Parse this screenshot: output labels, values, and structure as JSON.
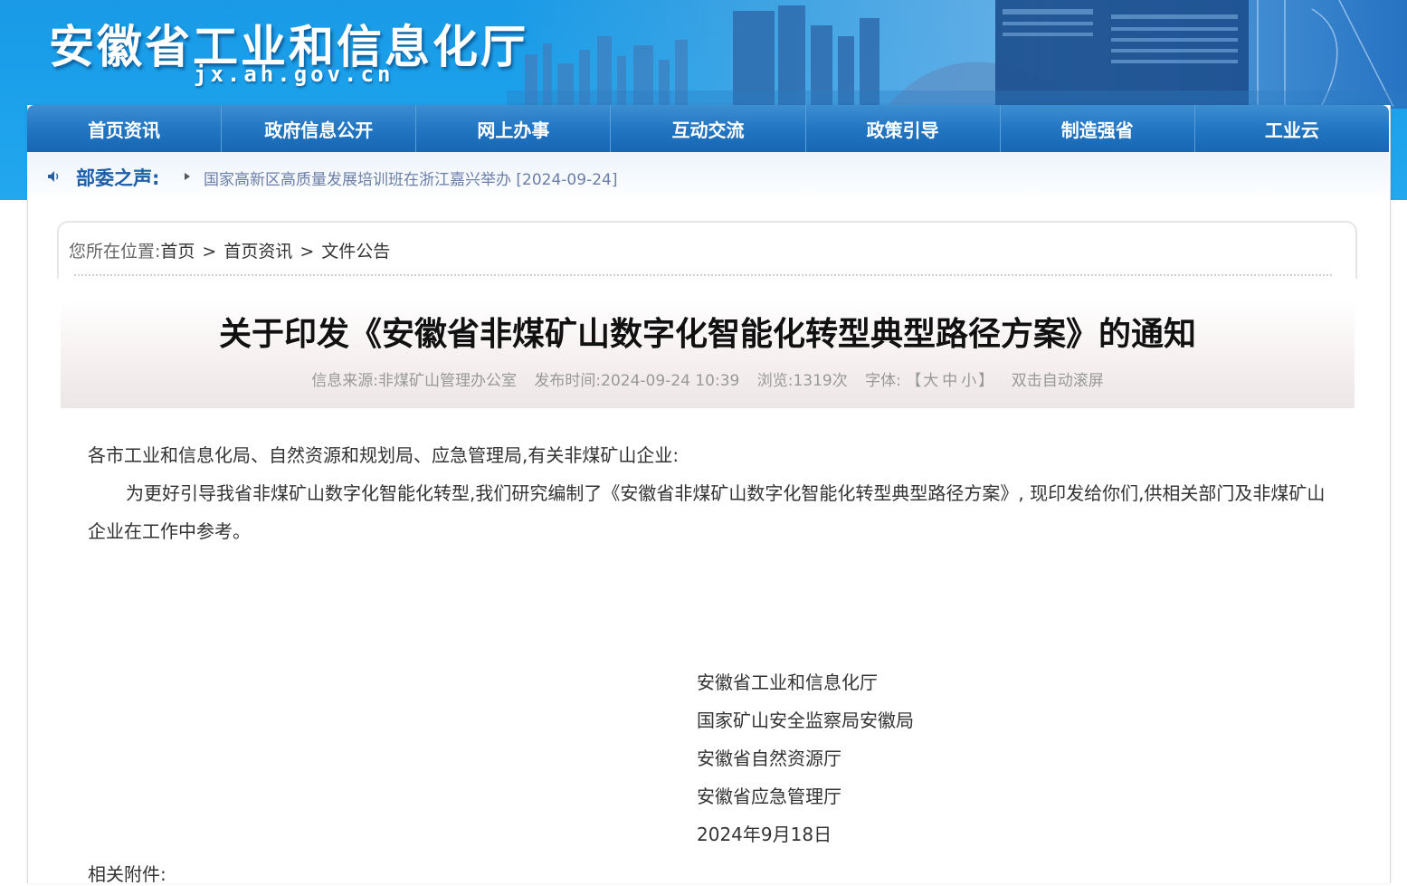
{
  "header": {
    "site_title": "安徽省工业和信息化厅",
    "site_domain": "jx.ah.gov.cn"
  },
  "nav": {
    "items": [
      "首页资讯",
      "政府信息公开",
      "网上办事",
      "互动交流",
      "政策引导",
      "制造强省",
      "工业云"
    ]
  },
  "notice": {
    "label": "部委之声:",
    "text": "国家高新区高质量发展培训班在浙江嘉兴举办 [2024-09-24]"
  },
  "breadcrumb": {
    "prefix": "您所在位置:",
    "items": [
      "首页",
      "首页资讯",
      "文件公告"
    ],
    "separator": ">"
  },
  "article": {
    "title": "关于印发《安徽省非煤矿山数字化智能化转型典型路径方案》的通知",
    "meta": {
      "source": "信息来源:非煤矿山管理办公室",
      "published": "发布时间:2024-09-24 10:39",
      "views": "浏览:1319次",
      "font_label": "字体:",
      "font_open": "【",
      "font_large": "大",
      "font_medium": "中",
      "font_small": "小",
      "font_close": "】",
      "autoscroll": "双击自动滚屏"
    },
    "salutation": "各市工业和信息化局、自然资源和规划局、应急管理局,有关非煤矿山企业:",
    "paragraph": "为更好引导我省非煤矿山数字化智能化转型,我们研究编制了《安徽省非煤矿山数字化智能化转型典型路径方案》, 现印发给你们,供相关部门及非煤矿山企业在工作中参考。",
    "signatories": [
      "安徽省工业和信息化厅",
      "国家矿山安全监察局安徽局",
      "安徽省自然资源厅",
      "安徽省应急管理厅"
    ],
    "date": "2024年9月18日",
    "attachments_label": "相关附件:"
  },
  "colors": {
    "banner": "#1ba0ea",
    "nav": "#2276c2",
    "notice_label": "#1e5fa8"
  }
}
